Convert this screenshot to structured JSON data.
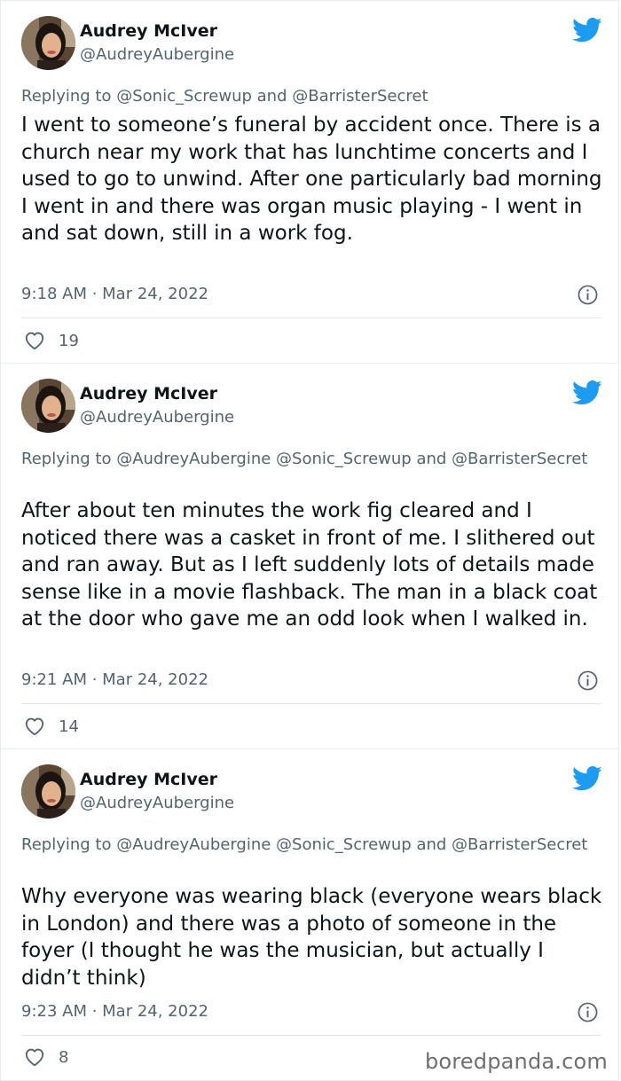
{
  "tweets": [
    {
      "author": "Audrey McIver",
      "handle": "@AudreyAubergine",
      "reply_prefix": "Replying to",
      "reply_to": "@Sonic_Screwup and @BarristerSecret",
      "body": "I went to someone’s funeral by accident once. There is a church near my work that has lunchtime concerts and I used to go to unwind. After one particularly bad morning I went in and there was organ music playing - I went in and sat down, still in a work fog.",
      "timestamp": "9:18 AM · Mar 24, 2022",
      "likes": "19"
    },
    {
      "author": "Audrey McIver",
      "handle": "@AudreyAubergine",
      "reply_prefix": "Replying to",
      "reply_to": "@AudreyAubergine @Sonic_Screwup and @BarristerSecret",
      "body": "After about ten minutes the work fig cleared and I noticed there was a casket in front of me. I slithered out and ran away. But as I left suddenly lots of details made sense like in a movie flashback. The man in a black coat at the door who gave me an odd look when I walked in.",
      "timestamp": "9:21 AM · Mar 24, 2022",
      "likes": "14"
    },
    {
      "author": "Audrey McIver",
      "handle": "@AudreyAubergine",
      "reply_prefix": "Replying to",
      "reply_to": "@AudreyAubergine @Sonic_Screwup and @BarristerSecret",
      "body": "Why everyone was wearing black (everyone wears black in London) and there was a photo of someone in the foyer (I thought he was the musician, but actually I didn’t think)",
      "timestamp": "9:23 AM · Mar 24, 2022",
      "likes": "8"
    }
  ],
  "icons": {
    "brand": "twitter-bird-icon",
    "info": "info-icon",
    "like": "heart-icon"
  },
  "colors": {
    "twitter_blue": "#1d9bf0",
    "text": "#0f1419",
    "secondary": "#536471"
  },
  "watermark": "boredpanda.com"
}
